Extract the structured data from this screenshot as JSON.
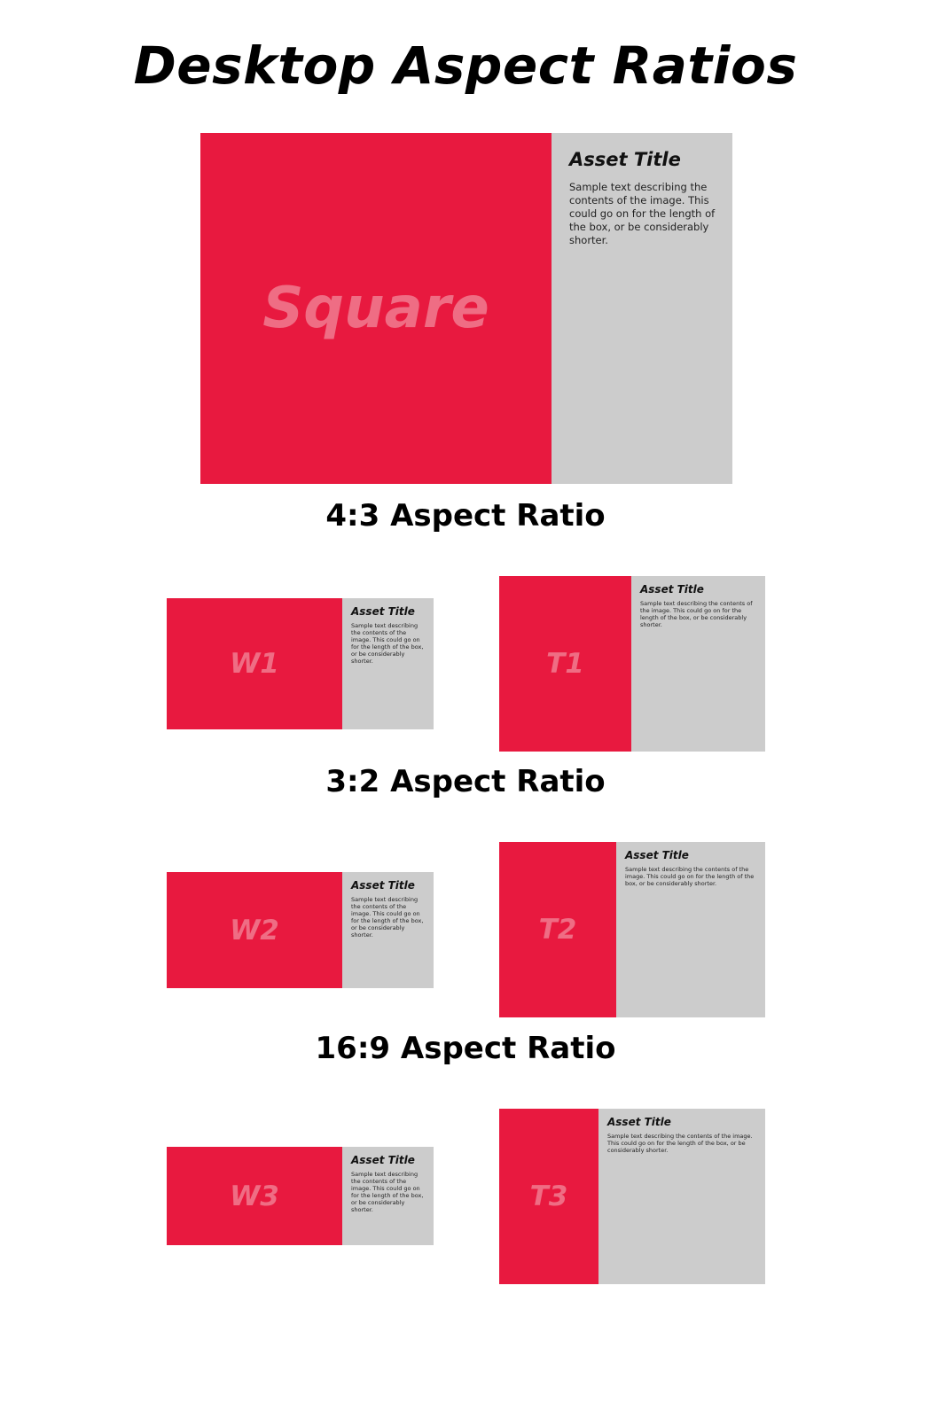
{
  "page": {
    "title": "Desktop Aspect Ratios"
  },
  "colors": {
    "image_fill": "#e8193f",
    "image_label": "#ef6d84",
    "panel_fill": "#cccccc",
    "text": "#000000"
  },
  "square": {
    "image_label": "Square",
    "title": "Asset Title",
    "description": "Sample text describing the contents of the image. This could go on for the length of the box, or be considerably shorter."
  },
  "sections": [
    {
      "heading": "4:3 Aspect Ratio",
      "wide": {
        "image_label": "W1",
        "title": "Asset Title",
        "description": "Sample text describing the contents of the image. This could go on for the length of the box, or be considerably shorter."
      },
      "tall": {
        "image_label": "T1",
        "title": "Asset Title",
        "description": "Sample text describing the contents of the image. This could go on for the length of the box, or be considerably shorter."
      }
    },
    {
      "heading": "3:2 Aspect Ratio",
      "wide": {
        "image_label": "W2",
        "title": "Asset Title",
        "description": "Sample text describing the contents of the image. This could go on for the length of the box, or be considerably shorter."
      },
      "tall": {
        "image_label": "T2",
        "title": "Asset Title",
        "description": "Sample text describing the contents of the image. This could go on for the length of the box, or be considerably shorter."
      }
    },
    {
      "heading": "16:9 Aspect Ratio",
      "wide": {
        "image_label": "W3",
        "title": "Asset Title",
        "description": "Sample text describing the contents of the image. This could go on for the length of the box, or be considerably shorter."
      },
      "tall": {
        "image_label": "T3",
        "title": "Asset Title",
        "description": "Sample text describing the contents of the image. This could go on for the length of the box, or be considerably shorter."
      }
    }
  ]
}
